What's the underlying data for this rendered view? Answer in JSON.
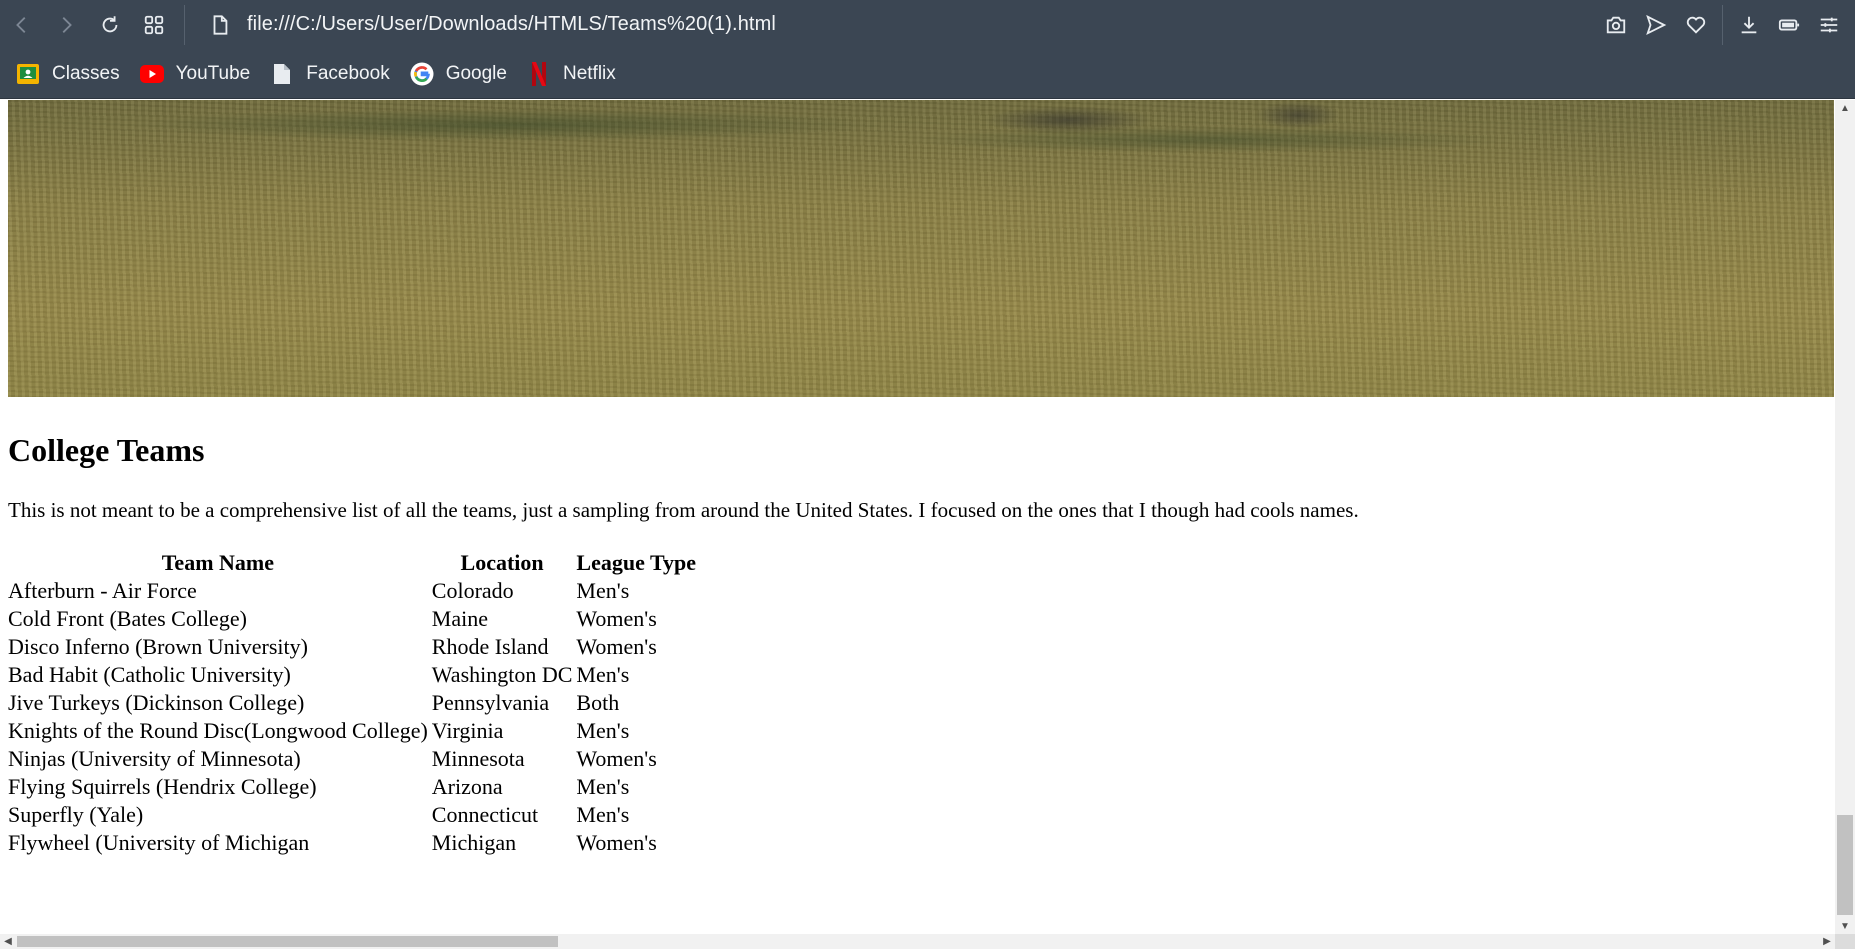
{
  "browser": {
    "url": "file:///C:/Users/User/Downloads/HTMLS/Teams%20(1).html",
    "icons": {
      "back": "back-arrow-icon",
      "forward": "forward-arrow-icon",
      "reload": "reload-icon",
      "speed_dial": "grid-icon",
      "page": "document-icon",
      "snapshot": "camera-icon",
      "send": "send-icon",
      "bookmark": "heart-icon",
      "downloads": "download-icon",
      "battery": "battery-icon",
      "easy_setup": "settings-sliders-icon"
    }
  },
  "bookmarks": [
    {
      "label": "Classes",
      "icon": "google-classroom-icon",
      "color": "#f4b400"
    },
    {
      "label": "YouTube",
      "icon": "youtube-icon",
      "color": "#ff0000"
    },
    {
      "label": "Facebook",
      "icon": "document-icon",
      "color": "#e8ecf0"
    },
    {
      "label": "Google",
      "icon": "google-icon",
      "color": "#4285f4"
    },
    {
      "label": "Netflix",
      "icon": "netflix-icon",
      "color": "#e50914"
    }
  ],
  "page": {
    "hero_image": "ultimate-frisbee-grass-field-photo",
    "title": "College Teams",
    "intro": "This is not meant to be a comprehensive list of all the teams, just a sampling from around the United States. I focused on the ones that I though had cools names.",
    "table": {
      "headers": [
        "Team Name",
        "Location",
        "League Type"
      ],
      "rows": [
        [
          "Afterburn - Air Force",
          "Colorado",
          "Men's"
        ],
        [
          "Cold Front (Bates College)",
          "Maine",
          "Women's"
        ],
        [
          "Disco Inferno (Brown University)",
          "Rhode Island",
          "Women's"
        ],
        [
          "Bad Habit (Catholic University)",
          "Washington DC",
          "Men's"
        ],
        [
          "Jive Turkeys (Dickinson College)",
          "Pennsylvania",
          "Both"
        ],
        [
          "Knights of the Round Disc(Longwood College)",
          "Virginia",
          "Men's"
        ],
        [
          "Ninjas (University of Minnesota)",
          "Minnesota",
          "Women's"
        ],
        [
          "Flying Squirrels (Hendrix College)",
          "Arizona",
          "Men's"
        ],
        [
          "Superfly (Yale)",
          "Connecticut",
          "Men's"
        ],
        [
          "Flywheel (University of Michigan",
          "Michigan",
          "Women's"
        ]
      ]
    }
  }
}
